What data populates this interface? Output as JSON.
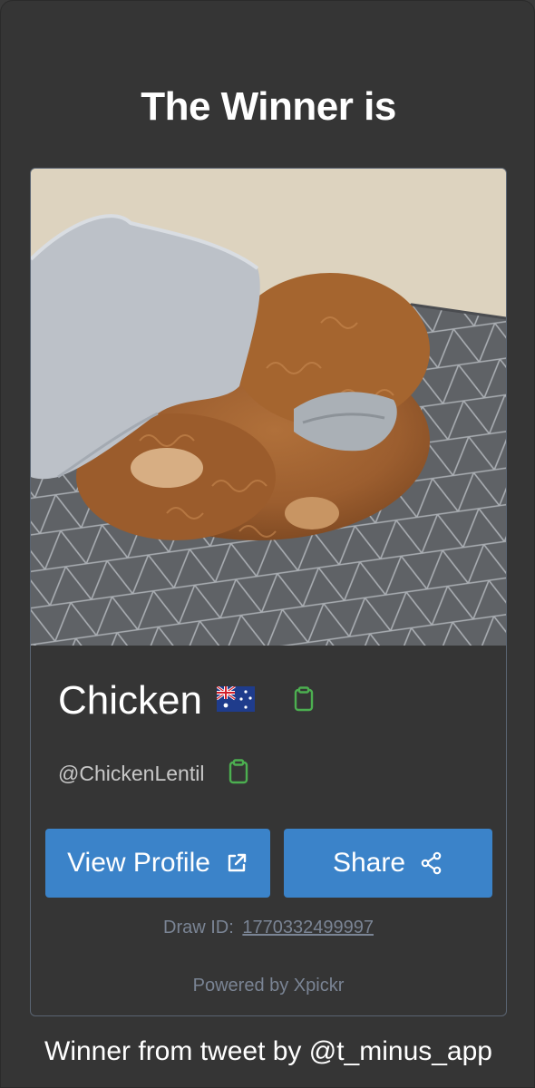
{
  "header": {
    "title": "The Winner is"
  },
  "winner": {
    "name": "Chicken",
    "flag": "australia-flag",
    "handle": "@ChickenLentil",
    "photo": "dog-under-blanket-photo"
  },
  "actions": {
    "view_profile_label": "View Profile",
    "share_label": "Share"
  },
  "draw": {
    "label": "Draw ID:",
    "id": "1770332499997"
  },
  "powered_by": "Powered by Xpickr",
  "footer": {
    "text": "Winner from tweet by @t_minus_app"
  },
  "colors": {
    "background": "#353535",
    "button": "#3b83c9",
    "clipboard_icon": "#4caf50",
    "muted_text": "#7a8494",
    "card_border": "#5a6472"
  },
  "icons": {
    "copy": "clipboard-icon",
    "external": "external-link-icon",
    "share": "share-icon"
  }
}
